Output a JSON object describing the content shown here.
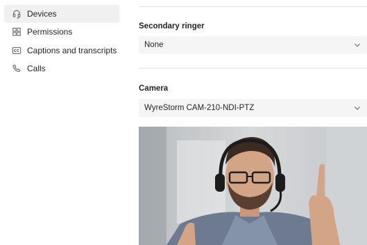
{
  "sidebar": {
    "items": [
      {
        "label": "Devices",
        "icon": "headset-icon",
        "active": true
      },
      {
        "label": "Permissions",
        "icon": "grid-icon",
        "active": false
      },
      {
        "label": "Captions and transcripts",
        "icon": "cc-icon",
        "active": false
      },
      {
        "label": "Calls",
        "icon": "phone-icon",
        "active": false
      }
    ]
  },
  "settings": {
    "secondary_ringer": {
      "label": "Secondary ringer",
      "value": "None"
    },
    "camera": {
      "label": "Camera",
      "value": "WyreStorm CAM-210-NDI-PTZ"
    }
  },
  "colors": {
    "accent_bg": "#f0f0f0",
    "field_bg": "#f5f5f5",
    "divider": "#e1e1e1"
  }
}
